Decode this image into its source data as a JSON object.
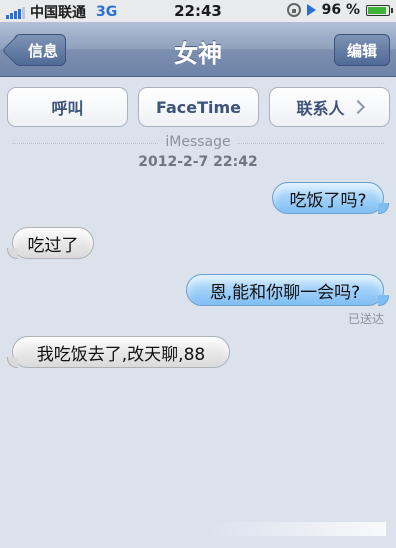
{
  "status_bar": {
    "carrier": "中国联通",
    "network": "3G",
    "time": "22:43",
    "battery": "96 %",
    "battery_level": 0.96
  },
  "nav": {
    "back_label": "信息",
    "title": "女神",
    "edit_label": "编辑"
  },
  "actions": {
    "call": "呼叫",
    "facetime": "FaceTime",
    "contact": "联系人"
  },
  "thread": {
    "service_label": "iMessage",
    "timestamp": "2012-2-7 22:42",
    "delivered": "已送达"
  },
  "messages": [
    {
      "direction": "outgoing",
      "text": "吃饭了吗?"
    },
    {
      "direction": "incoming",
      "text": "吃过了"
    },
    {
      "direction": "outgoing",
      "text": "恩,能和你聊一会吗?"
    },
    {
      "direction": "incoming",
      "text": "我吃饭去了,改天聊,88"
    }
  ],
  "colors": {
    "background": "#dbe2ec",
    "outgoing_bubble": "#7fbef3",
    "incoming_bubble": "#dadada",
    "nav_bar": "#8ea0bd"
  }
}
